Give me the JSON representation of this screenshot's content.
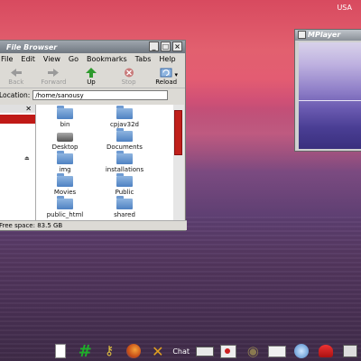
{
  "desktop": {
    "keyboard_layout": "USA"
  },
  "file_browser": {
    "title": "File Browser",
    "menu": [
      "File",
      "Edit",
      "View",
      "Go",
      "Bookmarks",
      "Tabs",
      "Help"
    ],
    "toolbar": [
      "Back",
      "Forward",
      "Up",
      "Stop",
      "Reload"
    ],
    "location_label": "Location:",
    "location_value": "/home/sanousy",
    "items": [
      {
        "name": "bin",
        "type": "folder"
      },
      {
        "name": "cpjav32d",
        "type": "folder"
      },
      {
        "name": "Desktop",
        "type": "desktop"
      },
      {
        "name": "Documents",
        "type": "folder"
      },
      {
        "name": "img",
        "type": "folder"
      },
      {
        "name": "installations",
        "type": "folder"
      },
      {
        "name": "Movies",
        "type": "folder"
      },
      {
        "name": "Public",
        "type": "folder"
      },
      {
        "name": "public_html",
        "type": "folder"
      },
      {
        "name": "shared",
        "type": "folder"
      }
    ],
    "status": "Free space: 83.5 GB"
  },
  "mplayer": {
    "title": "MPlayer"
  },
  "taskbar": {
    "items": [
      "notes-icon",
      "terminal-icon",
      "keys-icon",
      "firefox-icon",
      "xchat-icon",
      "xchat-label",
      "battery-icon",
      "video-icon",
      "gimp-icon",
      "mail-icon",
      "network-icon",
      "system-icon",
      "monitor-icon"
    ],
    "xchat_label": "Chat"
  },
  "colors": {
    "accent": "#c01a17",
    "folder": "#4f82c2"
  }
}
